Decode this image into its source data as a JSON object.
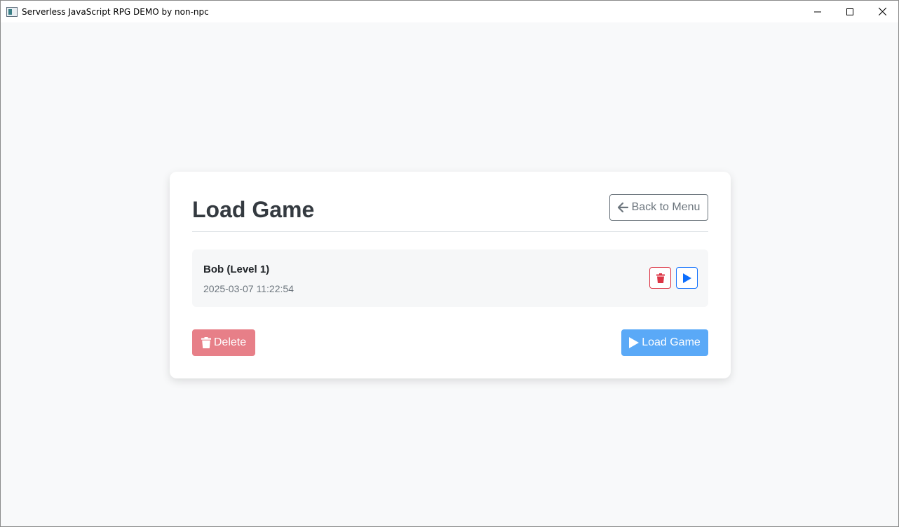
{
  "window": {
    "title": "Serverless JavaScript RPG DEMO by non-npc"
  },
  "header": {
    "title": "Load Game",
    "back_button_label": "Back to Menu"
  },
  "saves": [
    {
      "name": "Bob (Level 1)",
      "timestamp": "2025-03-07 11:22:54"
    }
  ],
  "actions": {
    "delete_label": "Delete",
    "load_label": "Load Game"
  },
  "colors": {
    "danger": "#dc3545",
    "primary": "#0d6efd",
    "delete_disabled": "#e77f88",
    "load_disabled": "#5aa9f7"
  }
}
